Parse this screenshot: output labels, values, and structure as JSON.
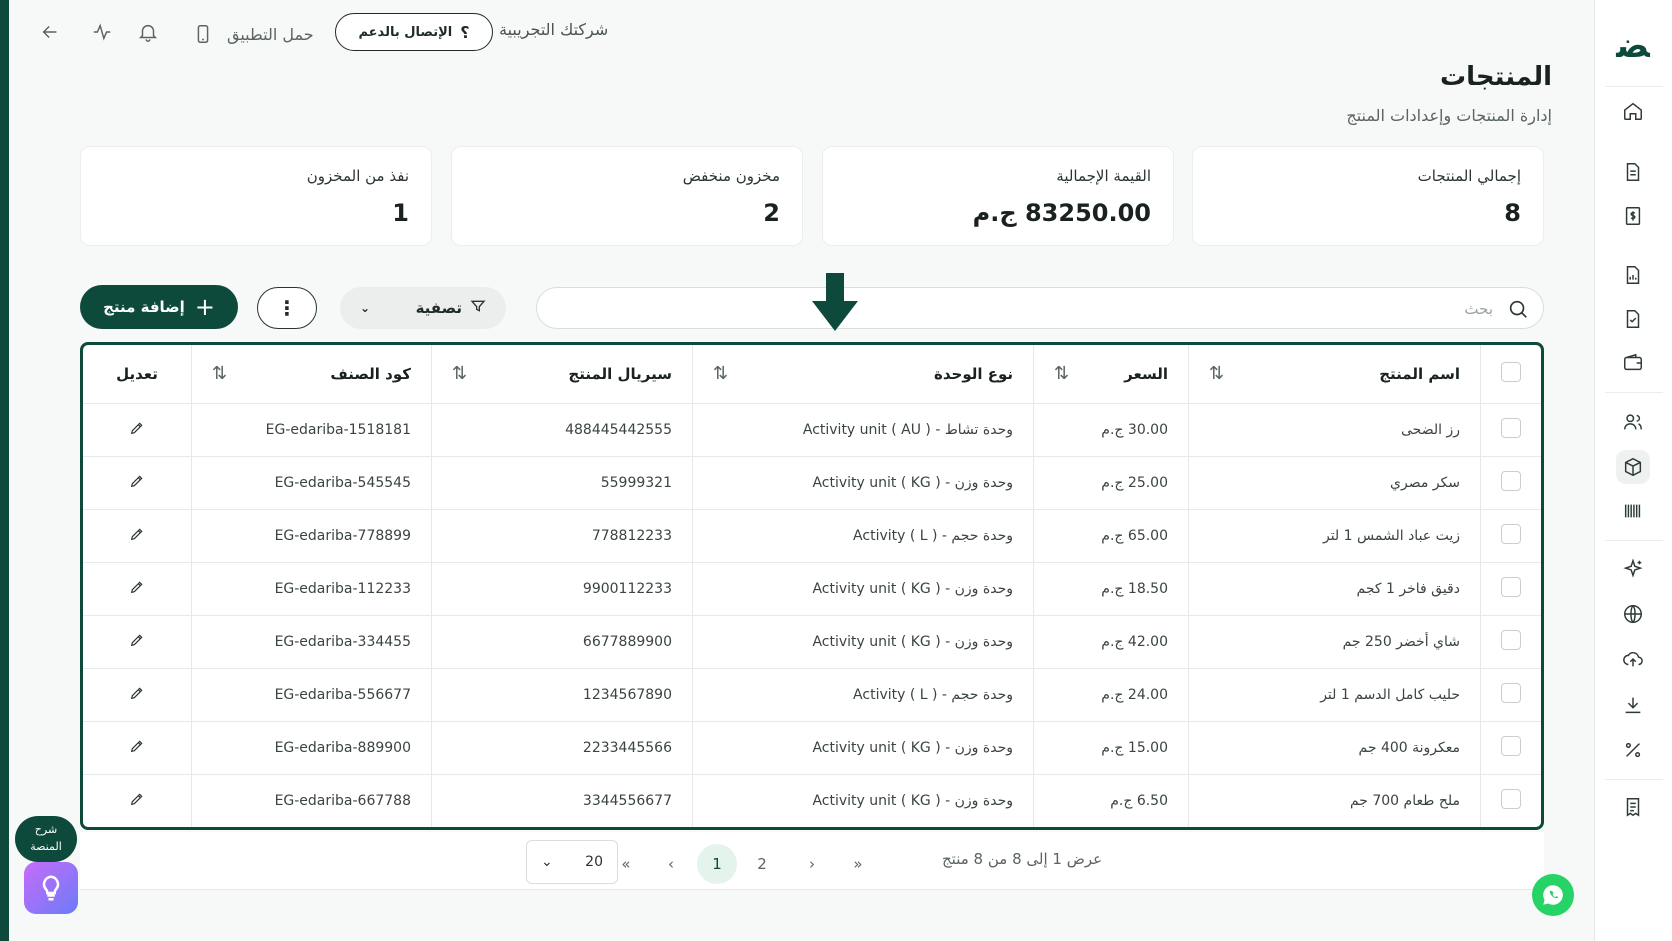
{
  "topbar": {
    "company": "شركتك التجريبية",
    "support_label": "الإتصال بالدعم",
    "app_label": "حمل التطبيق"
  },
  "header": {
    "title": "المنتجات",
    "subtitle": "إدارة المنتجات وإعدادات المنتج"
  },
  "stats": [
    {
      "label": "إجمالي المنتجات",
      "value": "8"
    },
    {
      "label": "القيمة الإجمالية",
      "value": "83250.00 ج.م"
    },
    {
      "label": "مخزون منخفض",
      "value": "2"
    },
    {
      "label": "نفذ من المخزون",
      "value": "1"
    }
  ],
  "toolbar": {
    "add_label": "إضافة منتج",
    "filter_label": "تصفية",
    "search_placeholder": "بحث"
  },
  "table": {
    "headers": {
      "name": "اسم المنتج",
      "price": "السعر",
      "unit": "نوع الوحدة",
      "serial": "سيريال المنتج",
      "code": "كود الصنف",
      "edit": "تعديل"
    },
    "rows": [
      {
        "name": "رز الضحى",
        "price": "30.00 ج.م",
        "unit": "وحدة تشاط - Activity unit ( AU )",
        "serial": "488445442555",
        "code": "EG-edariba-1518181"
      },
      {
        "name": "سكر مصري",
        "price": "25.00 ج.م",
        "unit": "وحدة وزن - Activity unit ( KG )",
        "serial": "55999321",
        "code": "EG-edariba-545545"
      },
      {
        "name": "زيت عباد الشمس 1 لتر",
        "price": "65.00 ج.م",
        "unit": "وحدة حجم - Activity ( L )",
        "serial": "778812233",
        "code": "EG-edariba-778899"
      },
      {
        "name": "دقيق فاخر 1 كجم",
        "price": "18.50 ج.م",
        "unit": "وحدة وزن - Activity unit ( KG )",
        "serial": "9900112233",
        "code": "EG-edariba-112233"
      },
      {
        "name": "شاي أخضر 250 جم",
        "price": "42.00 ج.م",
        "unit": "وحدة وزن - Activity unit ( KG )",
        "serial": "6677889900",
        "code": "EG-edariba-334455"
      },
      {
        "name": "حليب كامل الدسم 1 لتر",
        "price": "24.00 ج.م",
        "unit": "وحدة حجم - Activity ( L )",
        "serial": "1234567890",
        "code": "EG-edariba-556677"
      },
      {
        "name": "معكرونة 400 جم",
        "price": "15.00 ج.م",
        "unit": "وحدة وزن - Activity unit ( KG )",
        "serial": "2233445566",
        "code": "EG-edariba-889900"
      },
      {
        "name": "ملح طعام 700 جم",
        "price": "6.50 ج.م",
        "unit": "وحدة وزن - Activity unit ( KG )",
        "serial": "3344556677",
        "code": "EG-edariba-667788"
      }
    ]
  },
  "pagination": {
    "info": "عرض 1 إلى 8 من 8 منتج",
    "pages": [
      "1",
      "2"
    ],
    "current": "1",
    "page_size": "20"
  },
  "help": {
    "label_line1": "شرح",
    "label_line2": "المنصة"
  },
  "colors": {
    "brand": "#0d4a3c",
    "accent_light": "#e4f3ec"
  },
  "icons": [
    "home-icon",
    "document-icon",
    "dollar-icon",
    "report-icon",
    "checklist-icon",
    "wallet-icon",
    "users-icon",
    "box-icon",
    "barcode-icon",
    "sparkle-icon",
    "globe-icon",
    "upload-icon",
    "download-icon",
    "percent-icon",
    "receipt-icon"
  ]
}
